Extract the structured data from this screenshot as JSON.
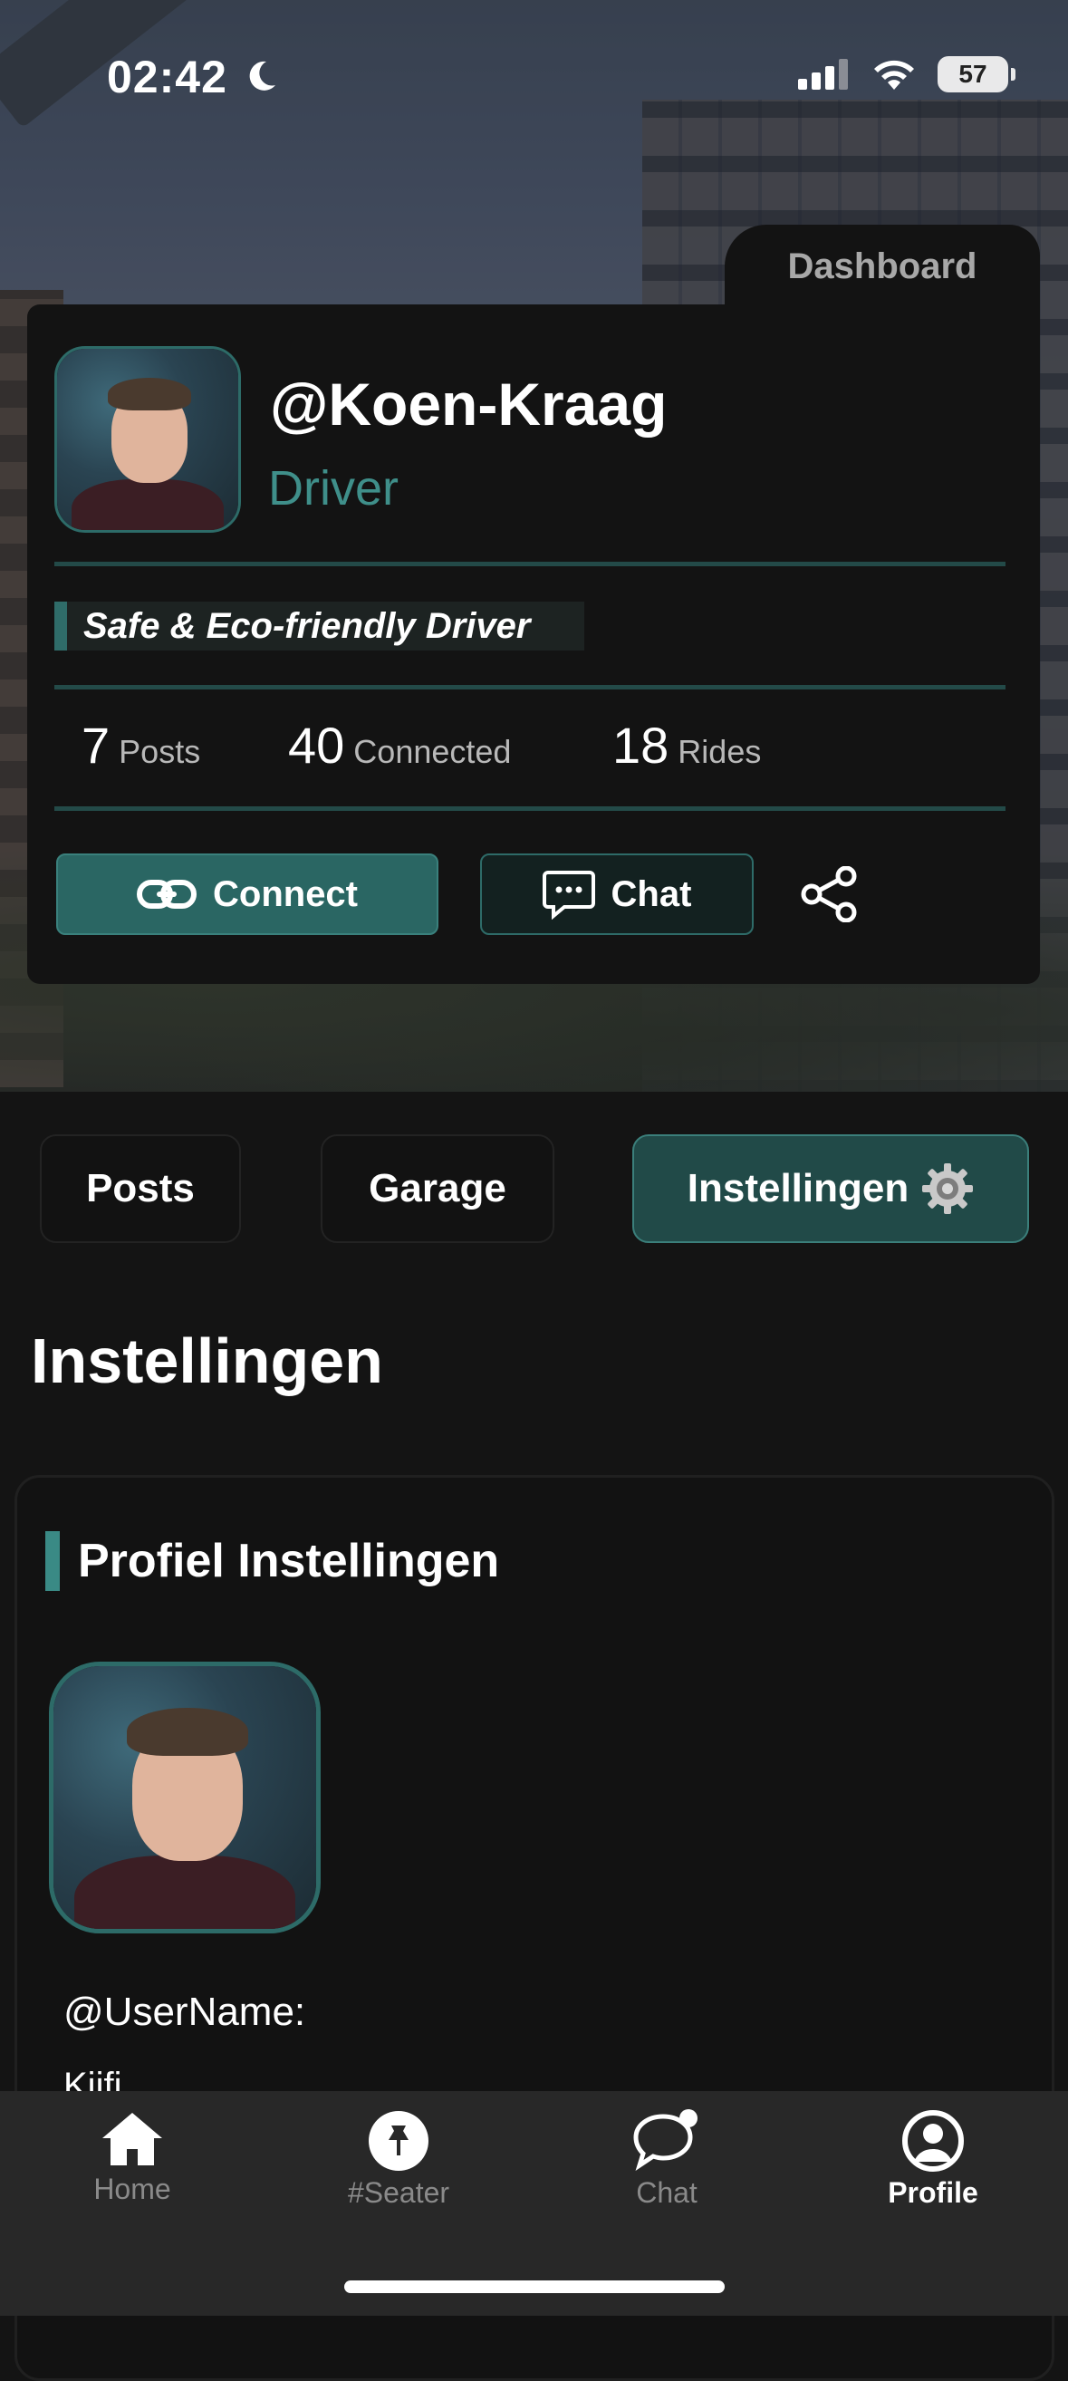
{
  "status_bar": {
    "time": "02:42",
    "battery": "57"
  },
  "profile": {
    "dashboard_tab": "Dashboard",
    "handle": "@Koen-Kraag",
    "role": "Driver",
    "bio": "Safe & Eco-friendly Driver",
    "stats": [
      {
        "value": "7",
        "label": "Posts"
      },
      {
        "value": "40",
        "label": "Connected"
      },
      {
        "value": "18",
        "label": "Rides"
      }
    ],
    "connect_label": "Connect",
    "chat_label": "Chat"
  },
  "tabs": {
    "posts": "Posts",
    "garage": "Garage",
    "settings": "Instellingen"
  },
  "page_title": "Instellingen",
  "settings_panel": {
    "title": "Profiel Instellingen",
    "username_label": "@UserName:",
    "username_value": "Kijfi"
  },
  "bottom_nav": [
    {
      "label": "Home",
      "icon": "home-icon"
    },
    {
      "label": "#Seater",
      "icon": "pin-icon"
    },
    {
      "label": "Chat",
      "icon": "chat-bubble-icon"
    },
    {
      "label": "Profile",
      "icon": "user-circle-icon",
      "active": true
    }
  ],
  "colors": {
    "accent": "#2a6663",
    "accent_text": "#3f8f8a",
    "background": "#141414"
  }
}
